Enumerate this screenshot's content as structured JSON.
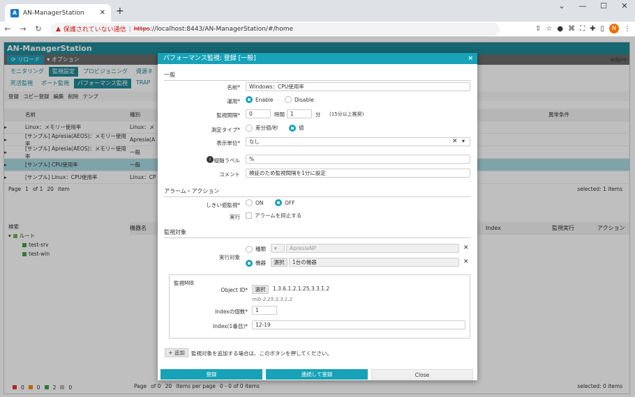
{
  "browser": {
    "tab_title": "AN-ManagerStation",
    "new_tab": "+",
    "url_warning": "保護されていない通信",
    "url_https": "https",
    "url_rest": "://localhost:8443/AN-ManagerStation/#/home",
    "avatar": "N"
  },
  "app": {
    "title": "AN-ManagerStation",
    "reload": "リロード",
    "option": "オプション",
    "user": "adpro",
    "tabs1": [
      "モニタリング",
      "監視設定",
      "プロビジョニング",
      "資源ネ"
    ],
    "tabs2": [
      "死活監視",
      "ポート監視",
      "パフォーマンス監視",
      "TRAP"
    ],
    "toolbar": [
      "登録",
      "コピー登録",
      "編集",
      "削除",
      "テンプ"
    ],
    "table_headers": [
      "名前",
      "種別"
    ],
    "rows": [
      [
        "Linux：メモリー使用率",
        "Linux：メ"
      ],
      [
        "[サンプル] Apresia(AEOS)：メモリー使用率",
        "Apresia(A"
      ],
      [
        "[サンプル] Apresia(AEOS)：メモリー使用率",
        "一般"
      ],
      [
        "[サンプル] CPU使用率",
        "一般"
      ],
      [
        "[サンプル] Linux：CPU使用率",
        "Linux：CP"
      ]
    ],
    "right_headers": [
      "異常条件"
    ],
    "pager": {
      "page": "Page",
      "num": "1",
      "of": "of 1",
      "size": "20",
      "items": "item",
      "selected": "selected: 1 items"
    },
    "tree_search": "検索",
    "tree": [
      "ルート",
      "test-srv",
      "test-win"
    ],
    "lower_headers": [
      "機器名",
      "Index",
      "監視実行",
      "アクション"
    ],
    "lower_pager": {
      "page": "Page",
      "of": "of 0",
      "size": "20",
      "items": "items per page",
      "range": "0 - 0 of 0 items",
      "selected": "selected: 0 items"
    },
    "status": [
      "0",
      "0",
      "2",
      "0"
    ]
  },
  "modal": {
    "title": "パフォーマンス監視: 登録 [一般]",
    "close_x": "×",
    "sec_general": "一般",
    "name_label": "名前*",
    "name_value": "Windows：CPU使用率",
    "op_label": "運用*",
    "enable": "Enable",
    "disable": "Disable",
    "interval_label": "監視間隔*",
    "hour_val": "0",
    "hour": "時間",
    "min_val": "1",
    "min": "分",
    "interval_note": "(15分以上推奨)",
    "mtype_label": "測定タイプ*",
    "diff": "差分値/秒",
    "value": "値",
    "unit_label": "表示単位*",
    "unit_value": "なし",
    "yaxis_label": "縦軸ラベル",
    "yaxis_value": "%",
    "comment_label": "コメント",
    "comment_value": "検証のため監視間隔を1分に設定",
    "sec_alarm": "アラーム・アクション",
    "threshold_label": "しきい値監視*",
    "on": "ON",
    "off": "OFF",
    "exec_label": "実行",
    "suppress": "アラームを抑止する",
    "sec_target": "監視対象",
    "target_label": "実行対象",
    "t_type": "種類",
    "t_type_val": "ApresiaNP",
    "t_device": "機器",
    "select": "選択",
    "device_count": "1台の機器",
    "mib_title": "監視MIB",
    "oid_label": "Object ID*",
    "oid_value": "1.3.6.1.2.1.25.3.3.1.2",
    "oid_name": "mib-2.25.3.3.1.2",
    "idxcount_label": "Indexの個数*",
    "idxcount_value": "1",
    "idx1_label": "Index(1番目)*",
    "idx1_value": "12-19",
    "add": "+ 追加",
    "add_note": "監視対象を追加する場合は、このボタンを押してください。",
    "register": "登録",
    "register_cont": "連続して登録",
    "close": "Close"
  }
}
